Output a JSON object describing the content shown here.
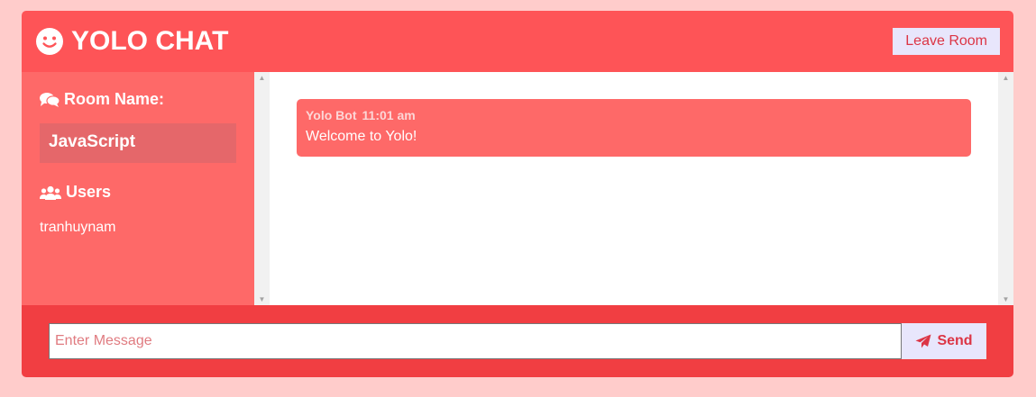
{
  "header": {
    "title": "YOLO CHAT",
    "logo_icon": "smile-icon",
    "leave_label": "Leave Room"
  },
  "sidebar": {
    "room_heading": "Room Name:",
    "room_icon": "comments-icon",
    "room_name": "JavaScript",
    "users_heading": "Users",
    "users_icon": "users-icon",
    "users": [
      "tranhuynam"
    ]
  },
  "messages": [
    {
      "author": "Yolo Bot",
      "time": "11:01 am",
      "text": "Welcome to Yolo!"
    }
  ],
  "footer": {
    "input_placeholder": "Enter Message",
    "input_value": "",
    "send_label": "Send",
    "send_icon": "paper-plane-icon"
  },
  "colors": {
    "page_bg": "#ffcccb",
    "header_bg": "#fe5457",
    "sidebar_bg": "#fe6968",
    "room_box_bg": "#e5676a",
    "footer_bg": "#f13e42",
    "button_bg": "#e8e6fc",
    "button_text": "#dc3545"
  }
}
